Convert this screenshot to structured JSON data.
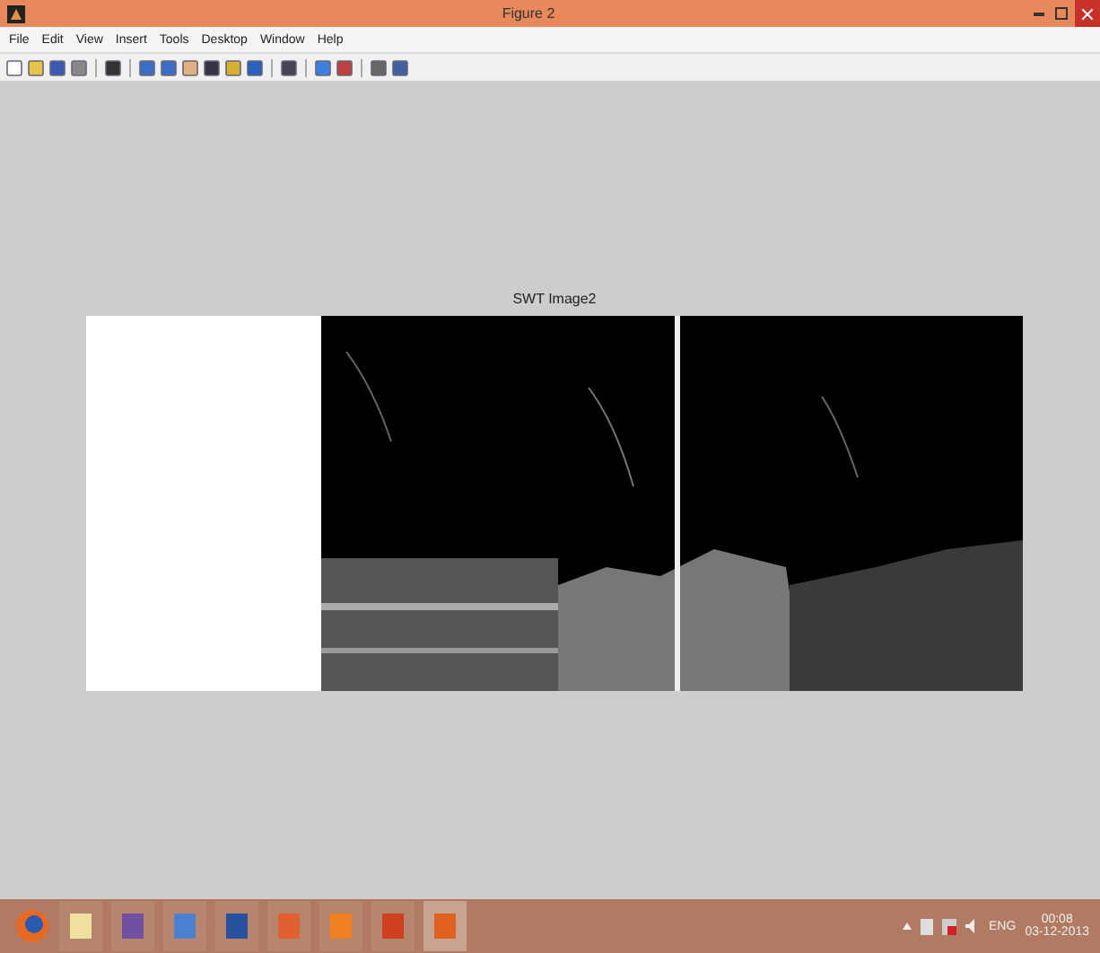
{
  "window": {
    "title": "Figure 2"
  },
  "menu": [
    {
      "label": "File"
    },
    {
      "label": "Edit"
    },
    {
      "label": "View"
    },
    {
      "label": "Insert"
    },
    {
      "label": "Tools"
    },
    {
      "label": "Desktop"
    },
    {
      "label": "Window"
    },
    {
      "label": "Help"
    }
  ],
  "figure": {
    "title": "SWT Image2",
    "kind": "picture"
  },
  "taskbar": {
    "apps": [
      {
        "selected": false
      },
      {
        "selected": false
      },
      {
        "selected": false
      },
      {
        "selected": false
      },
      {
        "selected": false
      },
      {
        "selected": false
      },
      {
        "selected": false
      },
      {
        "selected": true
      }
    ],
    "language": "ENG",
    "time": "00:08",
    "date": "03-12-2013"
  }
}
